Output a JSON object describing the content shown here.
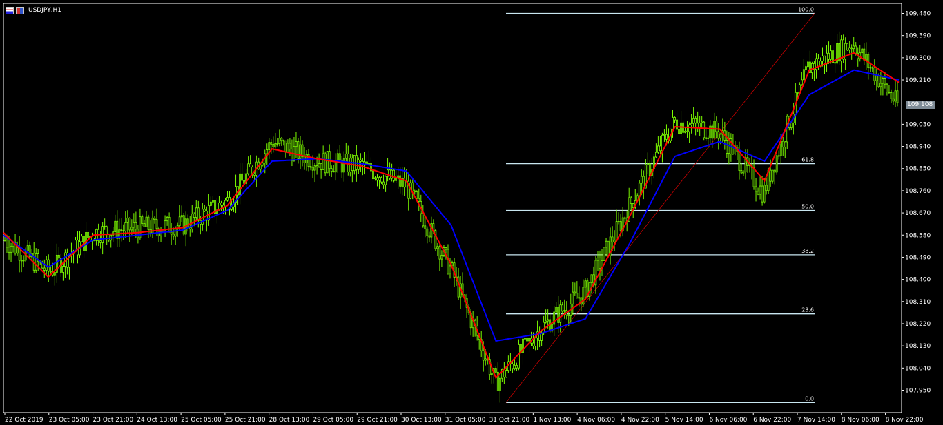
{
  "window": {
    "symbol_label": "USDJPY,H1",
    "icons": [
      "chart-window-icon",
      "symbol-flag-icon"
    ]
  },
  "colors": {
    "background": "#000000",
    "candle": "#7cfc00",
    "fast_ma": "#ff0000",
    "slow_ma": "#0000ff",
    "fibo_levels": "#c8e6f0",
    "price_line": "#778899",
    "axis": "#ffffff"
  },
  "price_axis": {
    "labels": [
      "109.480",
      "109.390",
      "109.300",
      "109.210",
      "109.030",
      "108.940",
      "108.850",
      "108.760",
      "108.670",
      "108.580",
      "108.490",
      "108.400",
      "108.310",
      "108.220",
      "108.130",
      "108.040",
      "107.950"
    ],
    "current_price": "109.108"
  },
  "time_axis": {
    "labels": [
      "22 Oct 2019",
      "23 Oct 05:00",
      "23 Oct 21:00",
      "24 Oct 13:00",
      "25 Oct 05:00",
      "25 Oct 21:00",
      "28 Oct 13:00",
      "29 Oct 05:00",
      "29 Oct 21:00",
      "30 Oct 13:00",
      "31 Oct 05:00",
      "31 Oct 21:00",
      "1 Nov 13:00",
      "4 Nov 06:00",
      "4 Nov 22:00",
      "5 Nov 14:00",
      "6 Nov 06:00",
      "6 Nov 22:00",
      "7 Nov 14:00",
      "8 Nov 06:00",
      "8 Nov 22:00"
    ]
  },
  "fibonacci": {
    "levels": [
      {
        "label": "100.0",
        "price": 109.48
      },
      {
        "label": "61.8",
        "price": 108.87
      },
      {
        "label": "50.0",
        "price": 108.68
      },
      {
        "label": "38.2",
        "price": 108.5
      },
      {
        "label": "23.6",
        "price": 108.26
      },
      {
        "label": "0.0",
        "price": 107.9
      }
    ]
  },
  "chart_data": {
    "type": "line",
    "symbol": "USDJPY",
    "timeframe": "H1",
    "x": [
      "22 Oct 2019",
      "23 Oct 05:00",
      "23 Oct 21:00",
      "24 Oct 13:00",
      "25 Oct 05:00",
      "25 Oct 21:00",
      "28 Oct 13:00",
      "29 Oct 05:00",
      "29 Oct 21:00",
      "30 Oct 13:00",
      "31 Oct 05:00",
      "31 Oct 21:00",
      "1 Nov 13:00",
      "4 Nov 06:00",
      "4 Nov 22:00",
      "5 Nov 14:00",
      "6 Nov 06:00",
      "6 Nov 22:00",
      "7 Nov 14:00",
      "8 Nov 06:00",
      "8 Nov 22:00"
    ],
    "series": [
      {
        "values": [
          108.56,
          108.43,
          108.59,
          108.61,
          108.62,
          108.72,
          108.96,
          108.88,
          108.86,
          108.78,
          108.44,
          107.98,
          108.2,
          108.35,
          108.7,
          109.04,
          109.0,
          108.75,
          109.26,
          109.36,
          109.11
        ]
      },
      {
        "values": [
          108.59,
          108.41,
          108.58,
          108.59,
          108.61,
          108.7,
          108.93,
          108.89,
          108.86,
          108.8,
          108.46,
          108.0,
          108.19,
          108.32,
          108.66,
          109.02,
          109.01,
          108.8,
          109.25,
          109.32,
          109.2
        ]
      },
      {
        "values": [
          108.58,
          108.45,
          108.56,
          108.58,
          108.6,
          108.68,
          108.88,
          108.89,
          108.87,
          108.84,
          108.62,
          108.15,
          108.18,
          108.24,
          108.55,
          108.9,
          108.96,
          108.88,
          109.15,
          109.25,
          109.21
        ]
      }
    ],
    "ylim": [
      107.9,
      109.5
    ],
    "grid": false
  }
}
